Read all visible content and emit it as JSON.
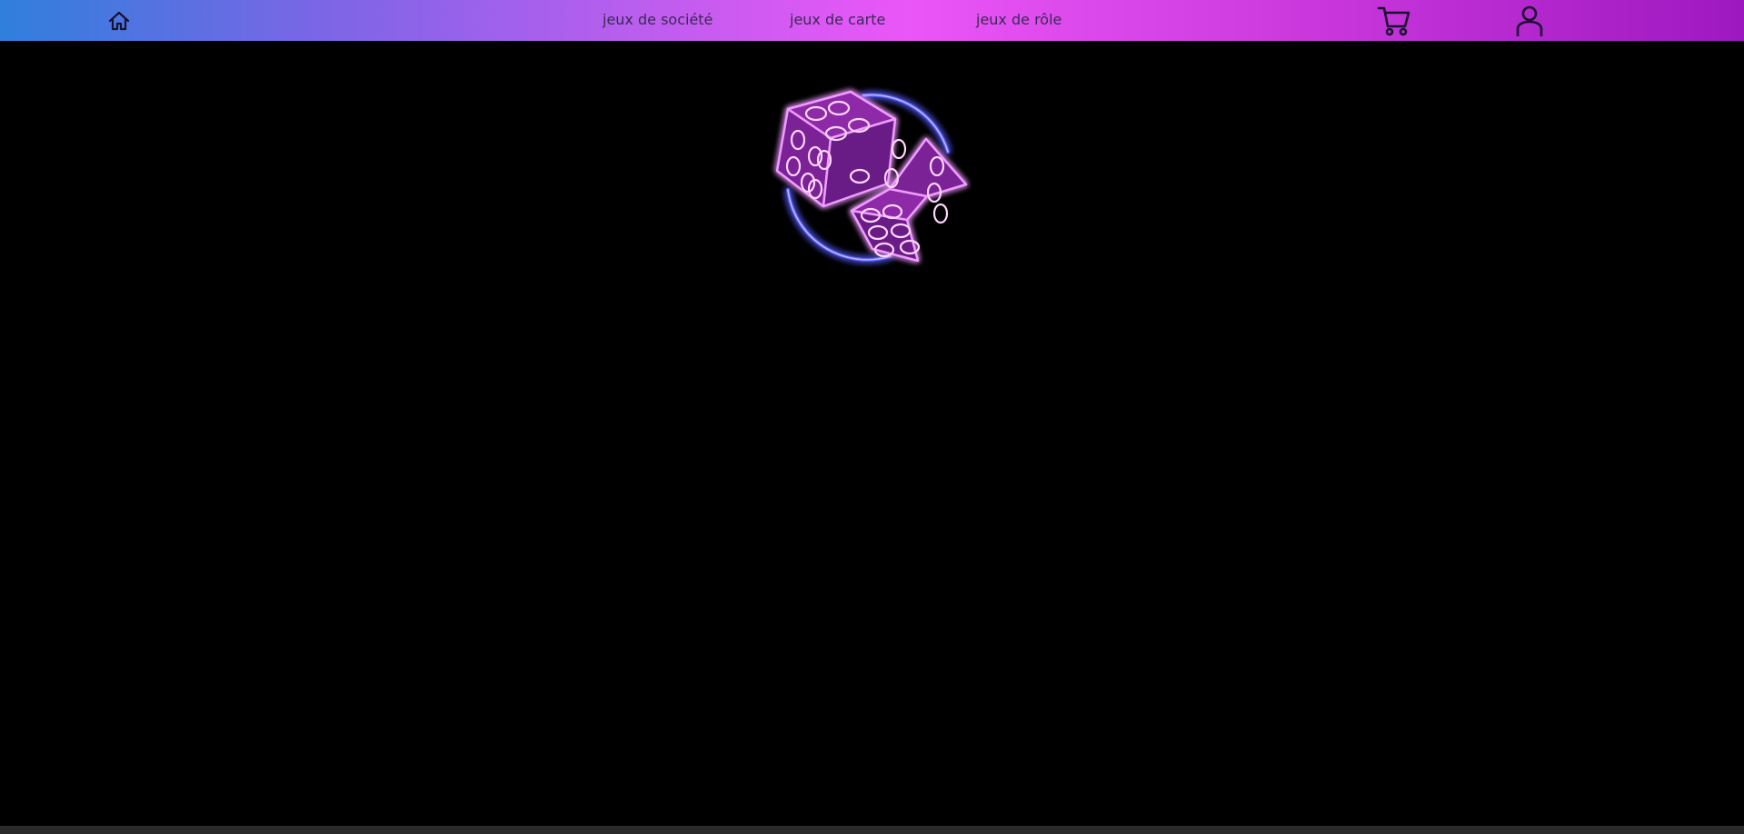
{
  "navbar": {
    "home_icon": "home-icon",
    "links": [
      {
        "label": "jeux de société"
      },
      {
        "label": "jeux de carte"
      },
      {
        "label": "jeux de rôle"
      }
    ],
    "cart_icon": "shopping-cart-icon",
    "user_icon": "user-icon",
    "gradient_colors": [
      "#2f7fdd",
      "#c65cf0",
      "#ea56f7",
      "#9e18c0"
    ]
  },
  "logo": {
    "icon": "neon-dice-logo",
    "colors": {
      "dice": "#e05cf2",
      "ring": "#4a4dff"
    }
  },
  "page": {
    "background": "#000000"
  }
}
